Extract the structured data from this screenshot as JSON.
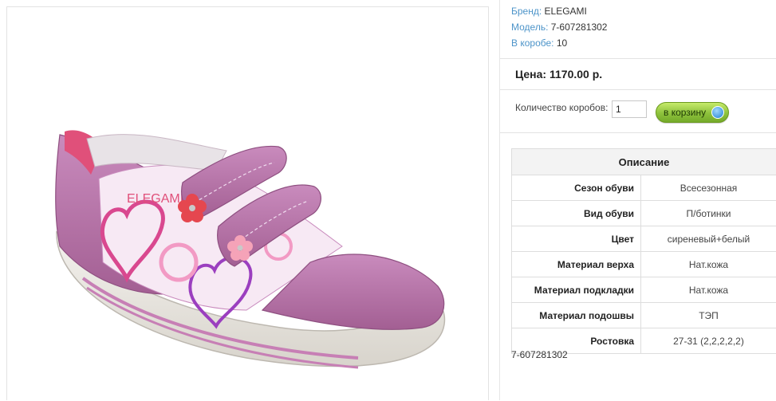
{
  "product": {
    "brand_label": "Бренд:",
    "brand": "ELEGAMI",
    "model_label": "Модель:",
    "model": "7-607281302",
    "box_label": "В коробе:",
    "box_qty": "10",
    "price": "Цена: 1170.00 р.",
    "quantity_label": "Количество коробов:",
    "quantity_value": "1",
    "cart_button": "в корзину",
    "sku_footer": "7-607281302"
  },
  "spec_table": {
    "header": "Описание",
    "rows": [
      {
        "key": "Сезон обуви",
        "value": "Всесезонная"
      },
      {
        "key": "Вид обуви",
        "value": "П/ботинки"
      },
      {
        "key": "Цвет",
        "value": "сиреневый+белый"
      },
      {
        "key": "Материал верха",
        "value": "Нат.кожа"
      },
      {
        "key": "Материал подкладки",
        "value": "Нат.кожа"
      },
      {
        "key": "Материал подошвы",
        "value": "ТЭП"
      },
      {
        "key": "Ростовка",
        "value": "27-31 (2,2,2,2,2)"
      }
    ]
  },
  "photo": {
    "subject": "shoe-image",
    "lettering": "ELEGAMI"
  },
  "colors": {
    "link_blue": "#4d94c9",
    "button_green": "#8dc23c",
    "shoe_lilac": "#b870a8"
  }
}
